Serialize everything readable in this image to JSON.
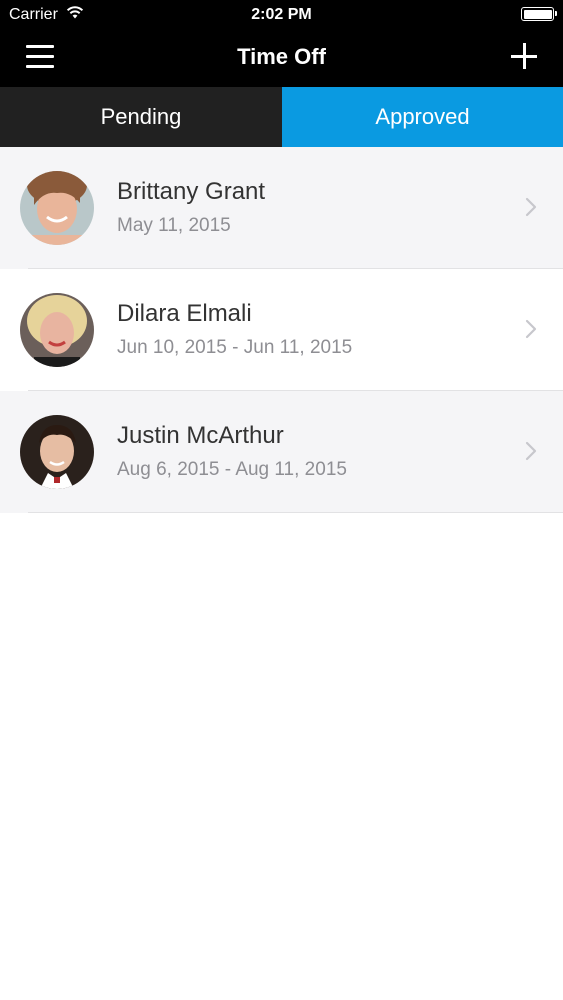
{
  "status_bar": {
    "carrier": "Carrier",
    "time": "2:02 PM",
    "wifi_icon": "wifi-icon",
    "battery_icon": "battery-full-icon",
    "battery_level": 1.0
  },
  "nav": {
    "title": "Time Off",
    "menu_icon": "hamburger-menu-icon",
    "add_icon": "plus-icon",
    "background": "#000000"
  },
  "tabs": [
    {
      "label": "Pending",
      "active": false,
      "background": "#212121"
    },
    {
      "label": "Approved",
      "active": true,
      "background": "#0a9ae1"
    }
  ],
  "requests": [
    {
      "name": "Brittany Grant",
      "dates": "May 11, 2015",
      "avatar": "avatar-photo"
    },
    {
      "name": "Dilara Elmali",
      "dates": "Jun 10, 2015 - Jun 11, 2015",
      "avatar": "avatar-photo"
    },
    {
      "name": "Justin McArthur",
      "dates": "Aug 6, 2015 - Aug 11, 2015",
      "avatar": "avatar-photo"
    }
  ],
  "colors": {
    "accent": "#0a9ae1",
    "row_alt": "#f5f5f7",
    "secondary_text": "#8e8e93",
    "chevron": "#c7c7cc"
  }
}
